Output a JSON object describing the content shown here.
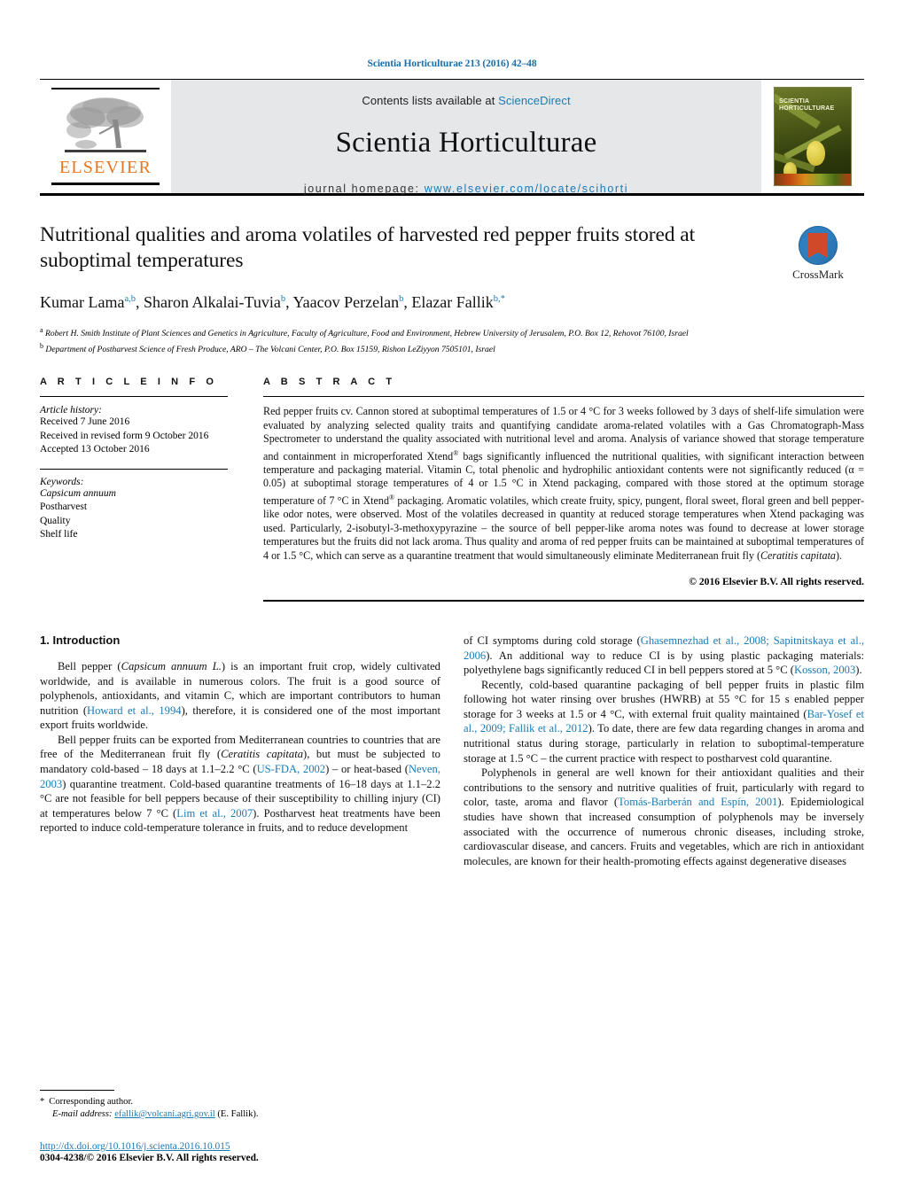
{
  "running_head": "Scientia Horticulturae 213 (2016) 42–48",
  "masthead": {
    "contents_prefix": "Contents lists available at ",
    "contents_link": "ScienceDirect",
    "journal_name": "Scientia Horticulturae",
    "homepage_label": "journal homepage: ",
    "homepage_url": "www.elsevier.com/locate/scihorti",
    "publisher_wordmark": "ELSEVIER",
    "cover_title": "SCIENTIA HORTICULTURAE"
  },
  "crossmark": {
    "label": "CrossMark"
  },
  "article": {
    "title": "Nutritional qualities and aroma volatiles of harvested red pepper fruits stored at suboptimal temperatures",
    "authors_html": "Kumar Lama, Sharon Alkalai-Tuvia, Yaacov Perzelan, Elazar Fallik",
    "authors": [
      {
        "name": "Kumar Lama",
        "marks": "a,b"
      },
      {
        "name": "Sharon Alkalai-Tuvia",
        "marks": "b"
      },
      {
        "name": "Yaacov Perzelan",
        "marks": "b"
      },
      {
        "name": "Elazar Fallik",
        "marks": "b,*"
      }
    ],
    "affiliations": [
      {
        "mark": "a",
        "text": "Robert H. Smith Institute of Plant Sciences and Genetics in Agriculture, Faculty of Agriculture, Food and Environment, Hebrew University of Jerusalem, P.O. Box 12, Rehovot 76100, Israel"
      },
      {
        "mark": "b",
        "text": "Department of Postharvest Science of Fresh Produce, ARO – The Volcani Center, P.O. Box 15159, Rishon LeZiyyon 7505101, Israel"
      }
    ]
  },
  "article_info": {
    "heading": "A R T I C L E   I N F O",
    "history_label": "Article history:",
    "history": [
      "Received 7 June 2016",
      "Received in revised form 9 October 2016",
      "Accepted 13 October 2016"
    ],
    "keywords_label": "Keywords:",
    "keywords": [
      "Capsicum annuum",
      "Postharvest",
      "Quality",
      "Shelf life"
    ],
    "keywords_italic_index": 0
  },
  "abstract": {
    "heading": "A B S T R A C T",
    "text": "Red pepper fruits cv. Cannon stored at suboptimal temperatures of 1.5 or 4 °C for 3 weeks followed by 3 days of shelf-life simulation were evaluated by analyzing selected quality traits and quantifying candidate aroma-related volatiles with a Gas Chromatograph-Mass Spectrometer to understand the quality associated with nutritional level and aroma. Analysis of variance showed that storage temperature and containment in microperforated Xtend® bags significantly influenced the nutritional qualities, with significant interaction between temperature and packaging material. Vitamin C, total phenolic and hydrophilic antioxidant contents were not significantly reduced (α = 0.05) at suboptimal storage temperatures of 4 or 1.5 °C in Xtend packaging, compared with those stored at the optimum storage temperature of 7 °C in Xtend® packaging. Aromatic volatiles, which create fruity, spicy, pungent, floral sweet, floral green and bell pepper-like odor notes, were observed. Most of the volatiles decreased in quantity at reduced storage temperatures when Xtend packaging was used. Particularly, 2-isobutyl-3-methoxypyrazine – the source of bell pepper-like aroma notes was found to decrease at lower storage temperatures but the fruits did not lack aroma. Thus quality and aroma of red pepper fruits can be maintained at suboptimal temperatures of 4 or 1.5 °C, which can serve as a quarantine treatment that would simultaneously eliminate Mediterranean fruit fly (Ceratitis capitata).",
    "copyright": "© 2016 Elsevier B.V. All rights reserved."
  },
  "introduction": {
    "section_number_title": "1.  Introduction",
    "left_paragraphs": [
      "Bell pepper (Capsicum annuum L.) is an important fruit crop, widely cultivated worldwide, and is available in numerous colors. The fruit is a good source of polyphenols, antioxidants, and vitamin C, which are important contributors to human nutrition (Howard et al., 1994), therefore, it is considered one of the most important export fruits worldwide.",
      "Bell pepper fruits can be exported from Mediterranean countries to countries that are free of the Mediterranean fruit fly (Ceratitis capitata), but must be subjected to mandatory cold-based – 18 days at 1.1–2.2 °C (US-FDA, 2002) – or heat-based (Neven, 2003) quarantine treatment. Cold-based quarantine treatments of 16–18 days at 1.1–2.2 °C are not feasible for bell peppers because of their susceptibility to chilling injury (CI) at temperatures below 7 °C (Lim et al., 2007). Postharvest heat treatments have been reported to induce cold-temperature tolerance in fruits, and to reduce development"
    ],
    "right_paragraphs": [
      "of CI symptoms during cold storage (Ghasemnezhad et al., 2008; Sapitnitskaya et al., 2006). An additional way to reduce CI is by using plastic packaging materials: polyethylene bags significantly reduced CI in bell peppers stored at 5 °C (Kosson, 2003).",
      "Recently, cold-based quarantine packaging of bell pepper fruits in plastic film following hot water rinsing over brushes (HWRB) at 55 °C for 15 s enabled pepper storage for 3 weeks at 1.5 or 4 °C, with external fruit quality maintained (Bar-Yosef et al., 2009; Fallik et al., 2012). To date, there are few data regarding changes in aroma and nutritional status during storage, particularly in relation to suboptimal-temperature storage at 1.5 °C – the current practice with respect to postharvest cold quarantine.",
      "Polyphenols in general are well known for their antioxidant qualities and their contributions to the sensory and nutritive qualities of fruit, particularly with regard to color, taste, aroma and flavor (Tomás-Barberán and Espín, 2001). Epidemiological studies have shown that increased consumption of polyphenols may be inversely associated with the occurrence of numerous chronic diseases, including stroke, cardiovascular disease, and cancers. Fruits and vegetables, which are rich in antioxidant molecules, are known for their health-promoting effects against degenerative diseases"
    ]
  },
  "footnote": {
    "corresponding_marker": "*",
    "corresponding_label": "Corresponding author.",
    "email_label": "E-mail address:",
    "email": "efallik@volcani.agri.gov.il",
    "email_suffix": "(E. Fallik).",
    "doi": "http://dx.doi.org/10.1016/j.scienta.2016.10.015",
    "issn_line": "0304-4238/© 2016 Elsevier B.V. All rights reserved."
  },
  "colors": {
    "link_blue": "#1a7ab5",
    "elsevier_orange": "#E87722",
    "masthead_grey": "#e6e7e8"
  }
}
